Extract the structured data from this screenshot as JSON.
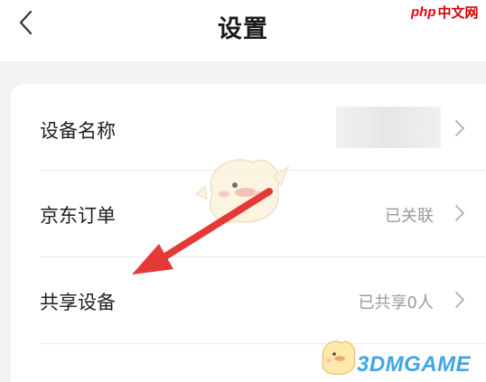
{
  "header": {
    "title": "设置",
    "back_icon": "chevron-left-icon"
  },
  "watermark_top": {
    "php_text": "php",
    "cn_text": "中文网"
  },
  "settings": {
    "items": [
      {
        "label": "设备名称",
        "value": "",
        "value_obscured": true
      },
      {
        "label": "京东订单",
        "value": "已关联"
      },
      {
        "label": "共享设备",
        "value": "已共享0人"
      }
    ]
  },
  "overlay": {
    "arrow_color": "#e53935",
    "arrow_target": "共享设备"
  },
  "watermark_bottom": {
    "brand_text": "3DMGAME",
    "brand_color": "#3fa7e6"
  }
}
